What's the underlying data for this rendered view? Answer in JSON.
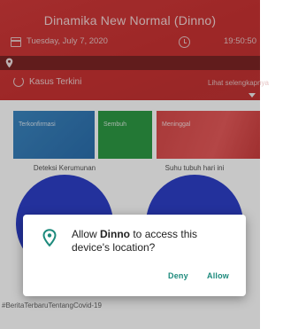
{
  "app": {
    "title": "Dinamika New Normal (Dinno)",
    "date": "Tuesday, July 7, 2020",
    "time": "19:50:50",
    "kasus_label": "Kasus Terkini",
    "lihat_link": "Lihat selengkapnya"
  },
  "cards": [
    {
      "label": "Terkonfirmasi",
      "color": "#2b6fae"
    },
    {
      "label": "Sembuh",
      "color": "#2e9a45"
    },
    {
      "label": "Meninggal",
      "color": "#d84a4a"
    }
  ],
  "sections": {
    "left_label": "Deteksi Kerumunan",
    "right_label": "Suhu tubuh hari ini"
  },
  "hashtag": "#BeritaTerbaruTentangCovid-19",
  "dialog": {
    "prefix": "Allow ",
    "app_name": "Dinno",
    "suffix": " to access this device's location?",
    "deny_label": "Deny",
    "allow_label": "Allow",
    "accent_color": "#1d8a7c",
    "icon": "location-pin-icon"
  },
  "colors": {
    "header_red": "#c93232",
    "location_bar": "#7d2424",
    "circle_blue": "#2d3fc8"
  }
}
